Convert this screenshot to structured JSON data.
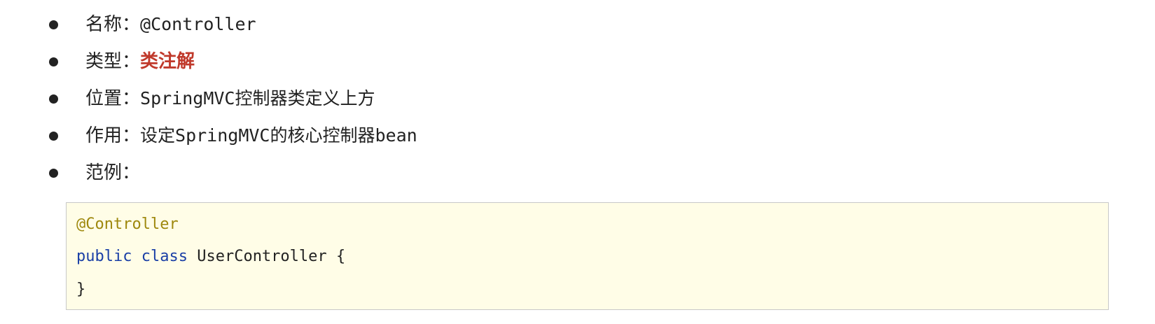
{
  "items": [
    {
      "label": "名称：",
      "value": "@Controller"
    },
    {
      "label": "类型：",
      "value": "类注解"
    },
    {
      "label": "位置：",
      "value": "SpringMVC控制器类定义上方"
    },
    {
      "label": "作用：",
      "value": "设定SpringMVC的核心控制器bean"
    },
    {
      "label": "范例：",
      "value": ""
    }
  ],
  "code": {
    "annotation": "@Controller",
    "kw_public": "public",
    "kw_class": "class",
    "class_decl": "UserController {",
    "closing": "}"
  },
  "colors": {
    "highlight": "#c0392b",
    "annotation": "#9e880d",
    "keyword": "#1a3fa6",
    "code_background": "#fffde7"
  }
}
